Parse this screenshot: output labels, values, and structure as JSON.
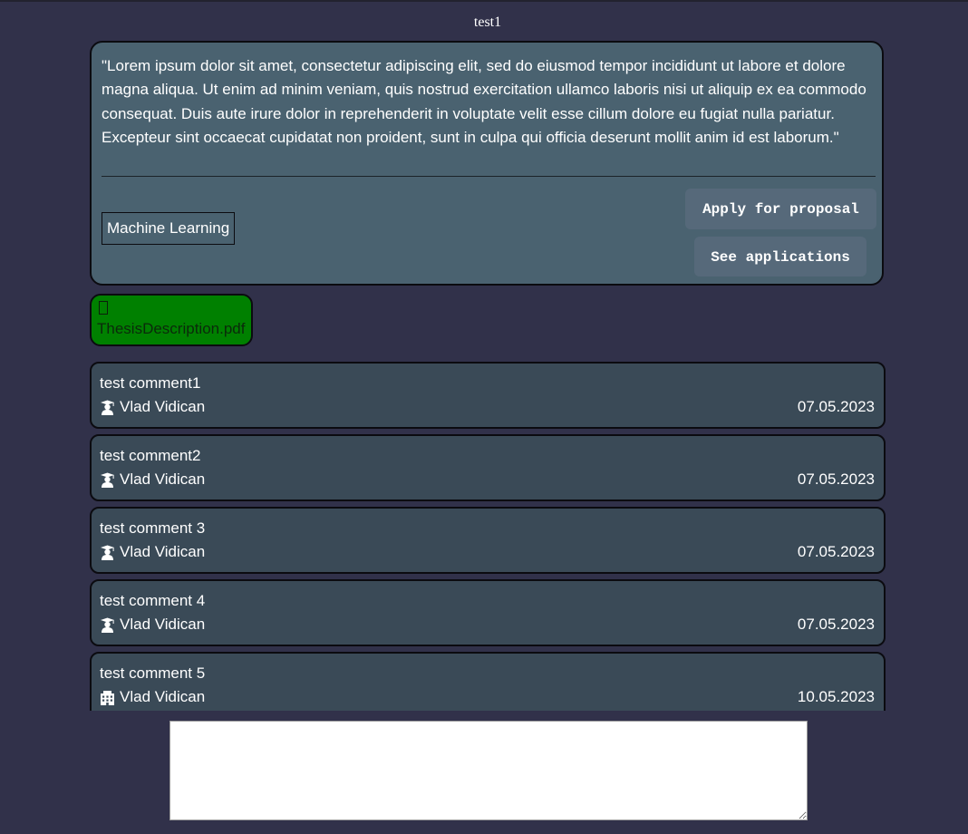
{
  "page": {
    "title": "test1"
  },
  "proposal": {
    "description": "\"Lorem ipsum dolor sit amet, consectetur adipiscing elit, sed do eiusmod tempor incididunt ut labore et dolore magna aliqua. Ut enim ad minim veniam, quis nostrud exercitation ullamco laboris nisi ut aliquip ex ea commodo consequat. Duis aute irure dolor in reprehenderit in voluptate velit esse cillum dolore eu fugiat nulla pariatur. Excepteur sint occaecat cupidatat non proident, sunt in culpa qui officia deserunt mollit anim id est laborum.\"",
    "tag": "Machine Learning",
    "apply_label": "Apply for proposal",
    "see_applications_label": "See applications"
  },
  "attachment": {
    "file_name": "ThesisDescription.pdf",
    "icon": "file-icon",
    "color": "#008000"
  },
  "comments": [
    {
      "text": "test comment1",
      "author": "Vlad Vidican",
      "author_icon": "graduation-cap-icon",
      "date": "07.05.2023"
    },
    {
      "text": "test comment2",
      "author": "Vlad Vidican",
      "author_icon": "graduation-cap-icon",
      "date": "07.05.2023"
    },
    {
      "text": "test comment 3",
      "author": "Vlad Vidican",
      "author_icon": "graduation-cap-icon",
      "date": "07.05.2023"
    },
    {
      "text": "test comment 4",
      "author": "Vlad Vidican",
      "author_icon": "graduation-cap-icon",
      "date": "07.05.2023"
    },
    {
      "text": "test comment 5",
      "author": "Vlad Vidican",
      "author_icon": "building-icon",
      "date": "10.05.2023"
    }
  ],
  "comment_input": {
    "value": "",
    "placeholder": ""
  },
  "colors": {
    "background": "#31314a",
    "proposal_card": "#4a6270",
    "comment_card": "#3a4a57",
    "button": "#56697a"
  }
}
